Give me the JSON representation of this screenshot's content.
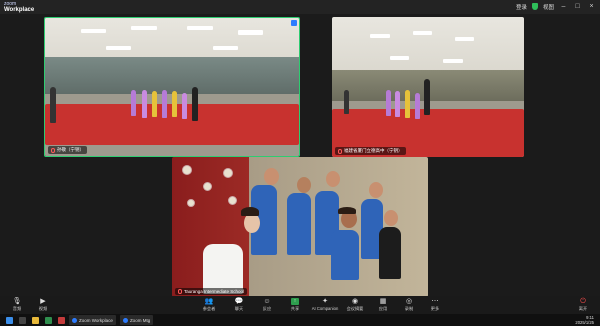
{
  "app": {
    "logo_small": "zoom",
    "logo_name": "Workplace",
    "login_label": "登录",
    "view_label": "视图"
  },
  "tiles": {
    "a_label": "孙敬（宁钥）",
    "b_label": "福建省厦门立德高中（宁钥）",
    "c_label": "Tauranga Intermediate School"
  },
  "toolbar": {
    "audio_label": "音频",
    "video_label": "视频",
    "participants_label": "参会者",
    "chat_label": "聊天",
    "react_label": "反应",
    "share_label": "共享",
    "companion_label": "AI Companion",
    "summary_label": "会议摘要",
    "apps_label": "应用",
    "record_label": "录制",
    "more_label": "更多",
    "end_label": "离开"
  },
  "taskbar": {
    "app1": "Zoom Workplace",
    "app2": "Zoom Mtg",
    "time": "9:11",
    "date": "2025/1/25"
  },
  "colors": {
    "active_speaker": "#2ecc71",
    "share": "#2e9e4e",
    "end": "#ff4d4d",
    "carpet": "#c8322f",
    "uniform": "#2f64b8"
  }
}
